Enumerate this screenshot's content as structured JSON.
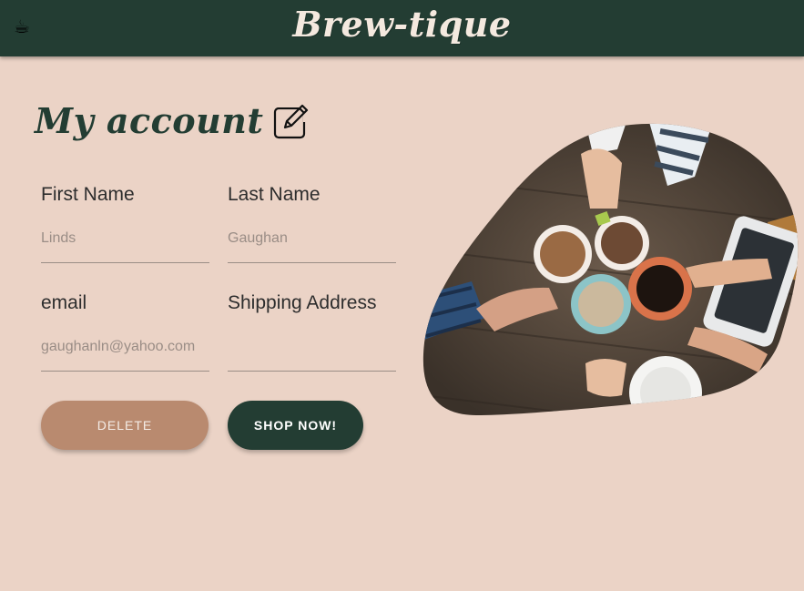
{
  "header": {
    "brand": "Brew-tique",
    "menu_icon": "coffee-cup-icon",
    "colors": {
      "background": "#233d33",
      "text": "#f4e9df"
    }
  },
  "page": {
    "title": "My account",
    "edit_icon": "pencil-edit-icon",
    "background": "#ebd3c6"
  },
  "form": {
    "first_name": {
      "label": "First Name",
      "value": "Linds"
    },
    "last_name": {
      "label": "Last Name",
      "value": "Gaughan"
    },
    "email": {
      "label": "email",
      "value": "gaughanln@yahoo.com"
    },
    "shipping": {
      "label": "Shipping Address",
      "value": ""
    }
  },
  "actions": {
    "delete_label": "DELETE",
    "shop_label": "SHOP NOW!",
    "colors": {
      "delete": "#b98a6f",
      "shop": "#233d33"
    }
  },
  "hero": {
    "icon": "coffee-cups-photo"
  }
}
